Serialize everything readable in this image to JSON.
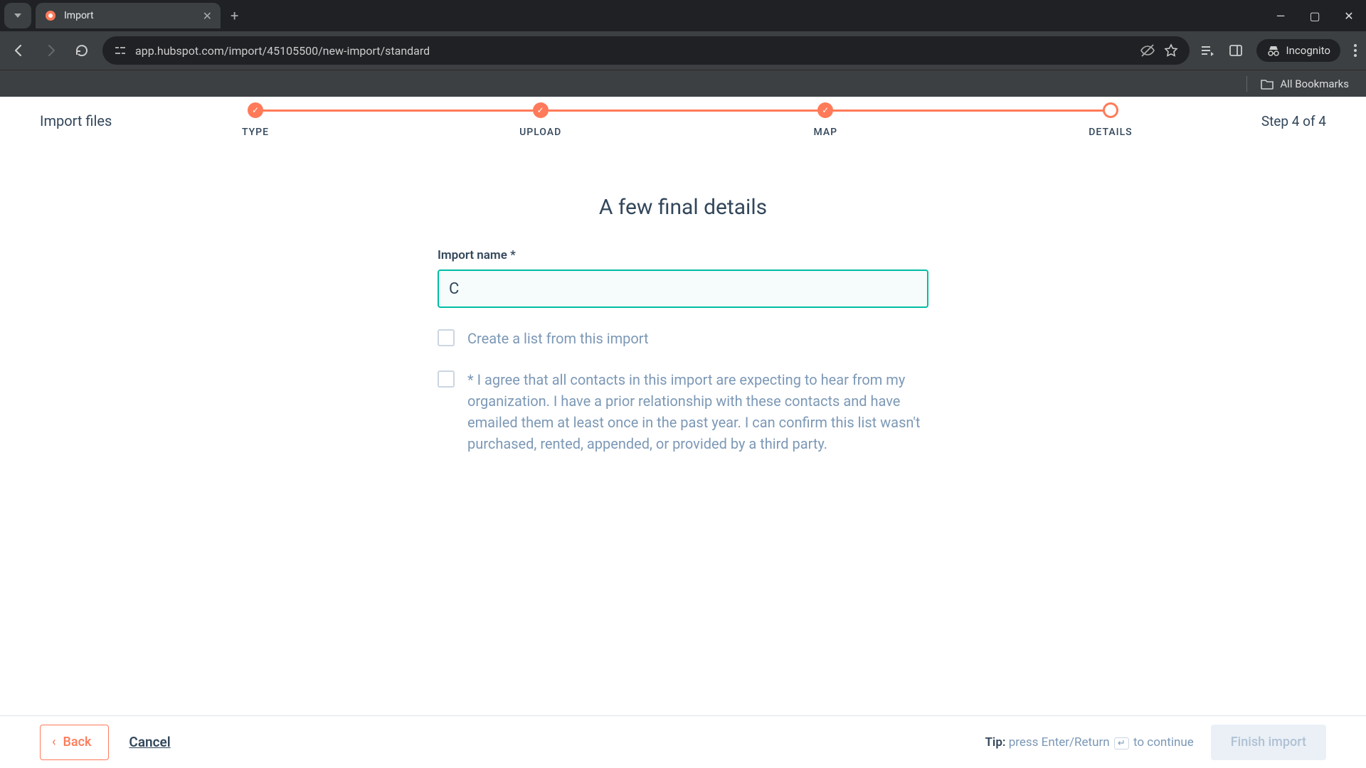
{
  "browser": {
    "tab_title": "Import",
    "url": "app.hubspot.com/import/45105500/new-import/standard",
    "incognito_label": "Incognito",
    "all_bookmarks": "All Bookmarks"
  },
  "header": {
    "title": "Import files",
    "step_text": "Step 4 of 4"
  },
  "stepper": {
    "steps": [
      "TYPE",
      "UPLOAD",
      "MAP",
      "DETAILS"
    ]
  },
  "form": {
    "heading": "A few final details",
    "import_name_label": "Import name *",
    "import_name_value": "C",
    "checkbox1_label": "Create a list from this import",
    "checkbox2_label": "* I agree that all contacts in this import are expecting to hear from my organization. I have a prior relationship with these contacts and have emailed them at least once in the past year. I can confirm this list wasn't purchased, rented, appended, or provided by a third party."
  },
  "footer": {
    "back": "Back",
    "cancel": "Cancel",
    "tip_bold": "Tip:",
    "tip_text": " press Enter/Return ",
    "tip_text2": " to continue",
    "finish": "Finish import"
  }
}
